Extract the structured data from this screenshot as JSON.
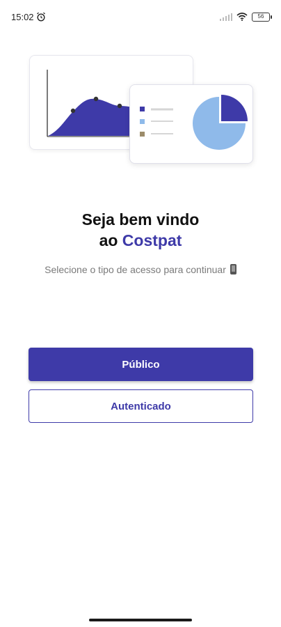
{
  "status_bar": {
    "time": "15:02",
    "battery": "56"
  },
  "welcome": {
    "line1": "Seja bem vindo",
    "line2_prefix": "ao ",
    "brand": "Costpat",
    "subtitle": "Selecione o tipo de acesso para continuar"
  },
  "buttons": {
    "public_label": "Público",
    "authenticated_label": "Autenticado"
  },
  "colors": {
    "primary": "#3e3aa8",
    "pie_light": "#8fbaea",
    "legend_tan": "#9c8c6a"
  },
  "icons": [
    "alarm-icon",
    "signal-icon",
    "wifi-icon",
    "battery-icon",
    "phone-emoji-icon"
  ]
}
